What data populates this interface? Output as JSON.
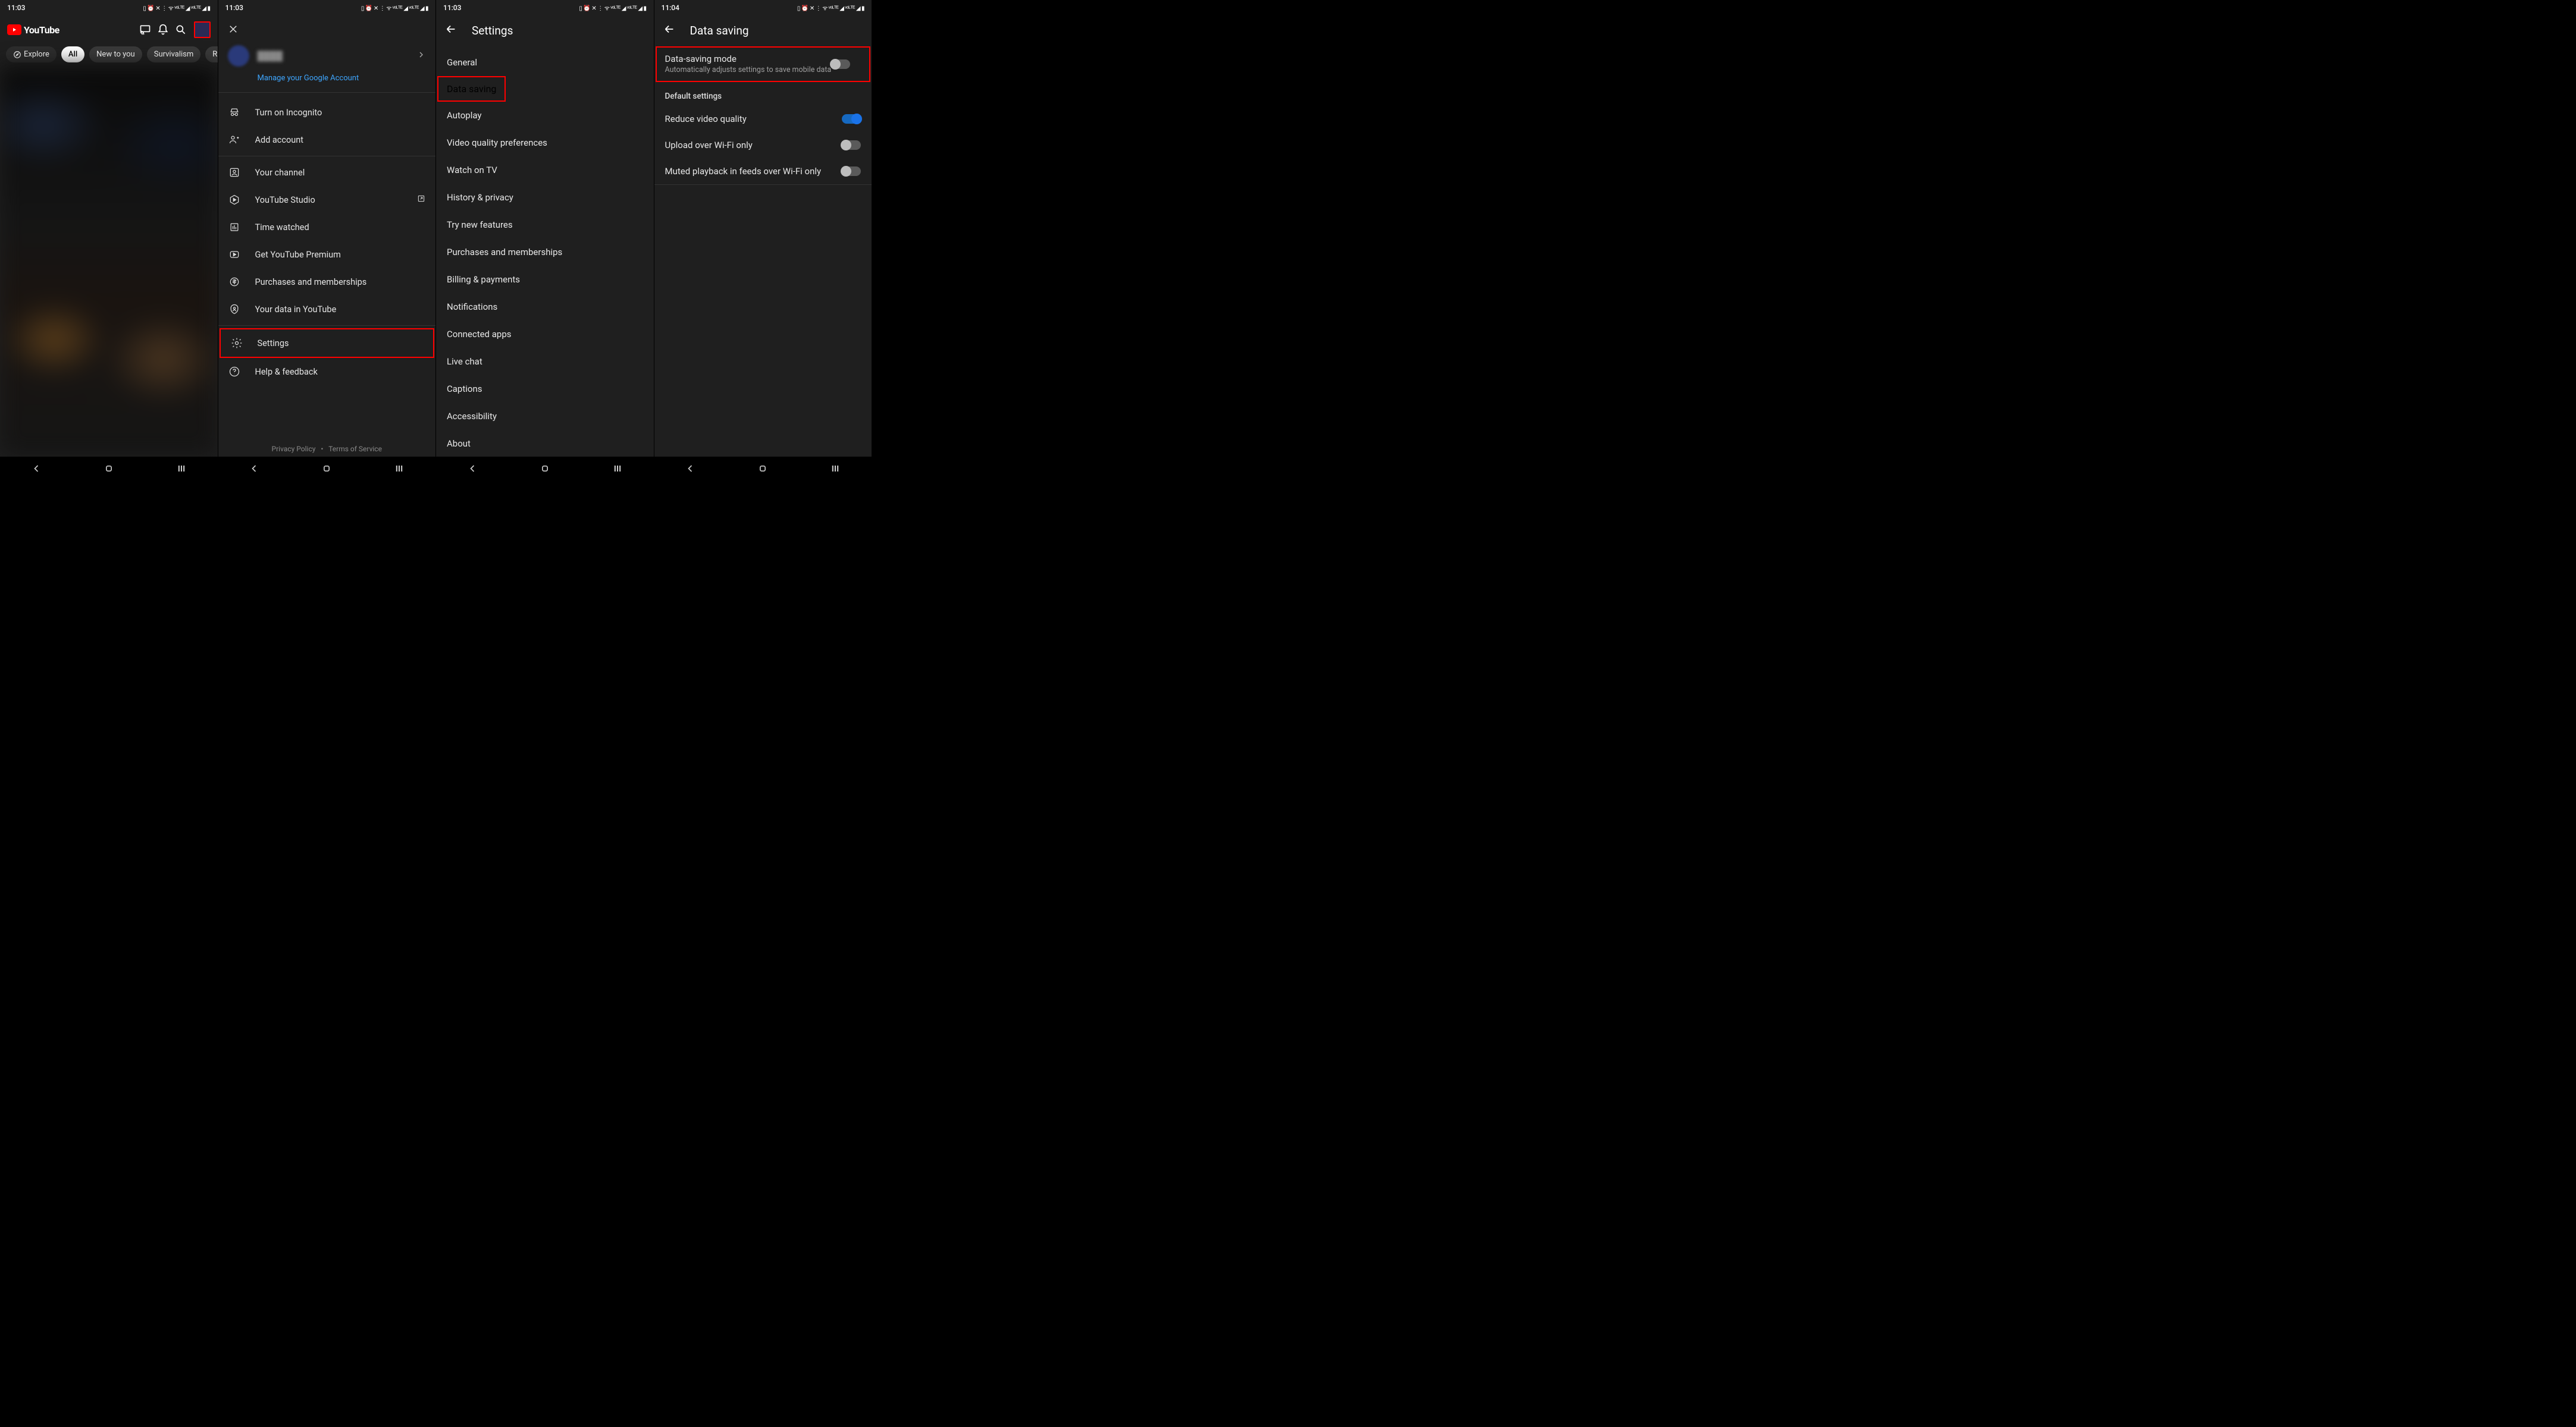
{
  "status": {
    "time1": "11:03",
    "time2": "11:03",
    "time3": "11:03",
    "time4": "11:04",
    "icons": "▯ ⏰ ✕ ⋮ ᯤ ᵛᵒᴸᵀᴱ ◢ ᵛᵒᴸᵀᴱ ◢ ▮"
  },
  "panel1": {
    "logo_text": "YouTube",
    "chips": {
      "explore": "Explore",
      "all": "All",
      "new": "New to you",
      "survivalism": "Survivalism",
      "ru": "Ru"
    }
  },
  "panel2": {
    "manage": "Manage your Google Account",
    "items": {
      "incognito": "Turn on Incognito",
      "add_account": "Add account",
      "your_channel": "Your channel",
      "studio": "YouTube Studio",
      "time_watched": "Time watched",
      "premium": "Get YouTube Premium",
      "purchases": "Purchases and memberships",
      "your_data": "Your data in YouTube",
      "settings": "Settings",
      "help": "Help & feedback"
    },
    "footer": {
      "privacy": "Privacy Policy",
      "dot": "•",
      "tos": "Terms of Service"
    }
  },
  "panel3": {
    "title": "Settings",
    "items": {
      "general": "General",
      "data_saving": "Data saving",
      "autoplay": "Autoplay",
      "video_quality": "Video quality preferences",
      "watch_tv": "Watch on TV",
      "history": "History & privacy",
      "try_new": "Try new features",
      "purchases": "Purchases and memberships",
      "billing": "Billing & payments",
      "notifications": "Notifications",
      "connected": "Connected apps",
      "live_chat": "Live chat",
      "captions": "Captions",
      "accessibility": "Accessibility",
      "about": "About"
    }
  },
  "panel4": {
    "title": "Data saving",
    "mode_title": "Data-saving mode",
    "mode_sub": "Automatically adjusts settings to save mobile data",
    "section": "Default settings",
    "items": {
      "reduce": "Reduce video quality",
      "upload_wifi": "Upload over Wi-Fi only",
      "muted_playback": "Muted playback in feeds over Wi-Fi only"
    }
  }
}
